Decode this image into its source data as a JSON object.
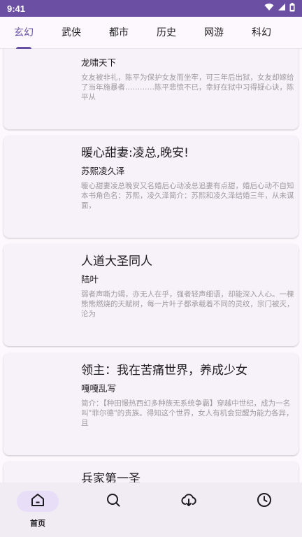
{
  "status_bar": {
    "time": "9:41"
  },
  "tabs": [
    {
      "label": "玄幻",
      "active": true
    },
    {
      "label": "武侠",
      "active": false
    },
    {
      "label": "都市",
      "active": false
    },
    {
      "label": "历史",
      "active": false
    },
    {
      "label": "网游",
      "active": false
    },
    {
      "label": "科幻",
      "active": false
    }
  ],
  "books": [
    {
      "title": "",
      "author": "龙啸天下",
      "desc": "女友被非礼，陈平为保护女友而坐牢，可三年后出狱，女友却嫁给了当年施暴者…………陈平悲愤不已，幸好在狱中习得疑心诀，陈平从"
    },
    {
      "title": "暖心甜妻:凌总,晚安!",
      "author": "苏熙凌久泽",
      "desc": "暖心甜妻凌总晚安又名婚后心动凌总追妻有点甜，婚后心动不自知本书角色名：苏熙，凌久泽简介：苏熙和凌久泽结婚三年，从未谋面，"
    },
    {
      "title": "人道大圣同人",
      "author": "陆叶",
      "desc": "弱者声嘶力竭，亦无人在乎，强者轻声细语，却能深入人心。一棵熊熊燃烧的天赋树，每一片叶子都承载着不同的灵纹，宗门被灭，沦为"
    },
    {
      "title": "领主：我在苦痛世界，养成少女",
      "author": "嘎嘎乱写",
      "desc": "简介：【种田慢热西幻多种族无系统争霸】穿越中世纪，成为一名叫\"菲尔德\"的贵族。得知这个世界，女人有机会觉醒为能力各异，且"
    },
    {
      "title": "兵家第一圣",
      "author": "",
      "desc": ""
    }
  ],
  "bottom_nav": [
    {
      "label": "首页",
      "icon": "home-icon",
      "active": true
    },
    {
      "label": "",
      "icon": "search-icon",
      "active": false
    },
    {
      "label": "",
      "icon": "download-icon",
      "active": false
    },
    {
      "label": "",
      "icon": "history-icon",
      "active": false
    }
  ],
  "colors": {
    "accent": "#6750a4",
    "status_bar": "#6a4fa3",
    "card_bg": "#f7f2f9"
  }
}
